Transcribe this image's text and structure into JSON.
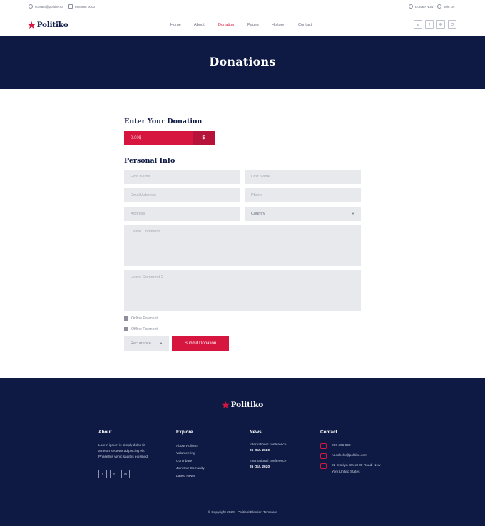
{
  "topbar": {
    "email": "contact@politike.ca",
    "phone": "888 888 0000",
    "donate": "Donate Now",
    "join": "Join Us"
  },
  "brand": {
    "name": "Politiko",
    "accent": "#d6163f",
    "navy": "#0e1a44"
  },
  "nav": {
    "items": [
      "Home",
      "About",
      "Donation",
      "Pages",
      "History",
      "Contact"
    ],
    "active": "Donation"
  },
  "social": [
    "twitter-icon",
    "facebook-icon",
    "dribbble-icon",
    "instagram-icon"
  ],
  "hero": {
    "title": "Donations"
  },
  "form": {
    "donation_title": "Enter Your Donation",
    "donation_amount": "0.00$",
    "currency_symbol": "$",
    "personal_title": "Personal Info",
    "first_name": "First Name",
    "last_name": "Last Name",
    "email": "Email Address",
    "phone": "Phone",
    "address": "Address",
    "country": "Country",
    "comment": "Leave Comment",
    "comment2": "Leave Comment-2",
    "online_payment": "Online Payment",
    "offline_payment": "Offline Payment",
    "recurrence": "Recurrence",
    "submit": "Submit Donation"
  },
  "footer": {
    "logo": "Politiko",
    "about_title": "About",
    "about_lines": [
      "Lorem ipsum is simply dolor sit",
      "ameton sectetur adipiscing elit.",
      "Phasellus vehic sagittis euismod."
    ],
    "explore_title": "Explore",
    "explore_links": [
      "About Polisen",
      "Volunteering",
      "Contribute",
      "Join Our Comunity",
      "Latest News"
    ],
    "news_title": "News",
    "news": [
      {
        "title": "International conference",
        "date": "26 Oct. 2020"
      },
      {
        "title": "International conference",
        "date": "26 Oct. 2020"
      }
    ],
    "contact_title": "Contact",
    "contact_phone": "000 666 999",
    "contact_email": "needhelp@politiko.com",
    "contact_address_1": "22 Broklyn Street 30 Road. New",
    "contact_address_2": "York United States",
    "copyright": "© Copyright 2020 - Political Election Template"
  }
}
